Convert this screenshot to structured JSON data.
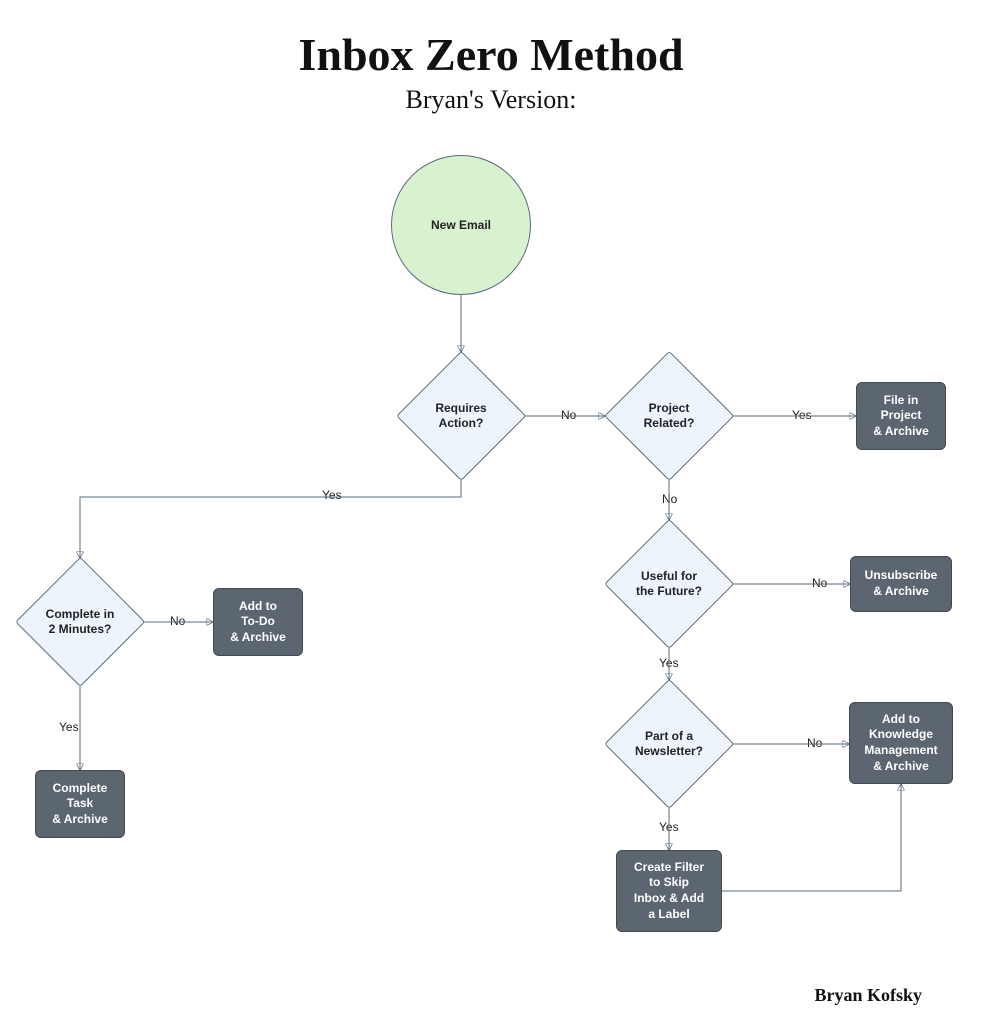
{
  "title": "Inbox Zero Method",
  "subtitle": "Bryan's Version:",
  "author": "Bryan Kofsky",
  "nodes": {
    "start": "New Email",
    "requiresAction": "Requires\nAction?",
    "completeIn2": "Complete in\n2 Minutes?",
    "addToDo": "Add to\nTo-Do\n& Archive",
    "completeTask": "Complete\nTask\n& Archive",
    "projectRelated": "Project\nRelated?",
    "fileProject": "File in\nProject\n& Archive",
    "usefulFuture": "Useful for\nthe Future?",
    "unsubscribe": "Unsubscribe\n& Archive",
    "newsletter": "Part of a\nNewsletter?",
    "addKM": "Add to\nKnowledge\nManagement\n& Archive",
    "createFilter": "Create Filter\nto Skip\nInbox & Add\na Label"
  },
  "edges": {
    "yes": "Yes",
    "no": "No"
  }
}
